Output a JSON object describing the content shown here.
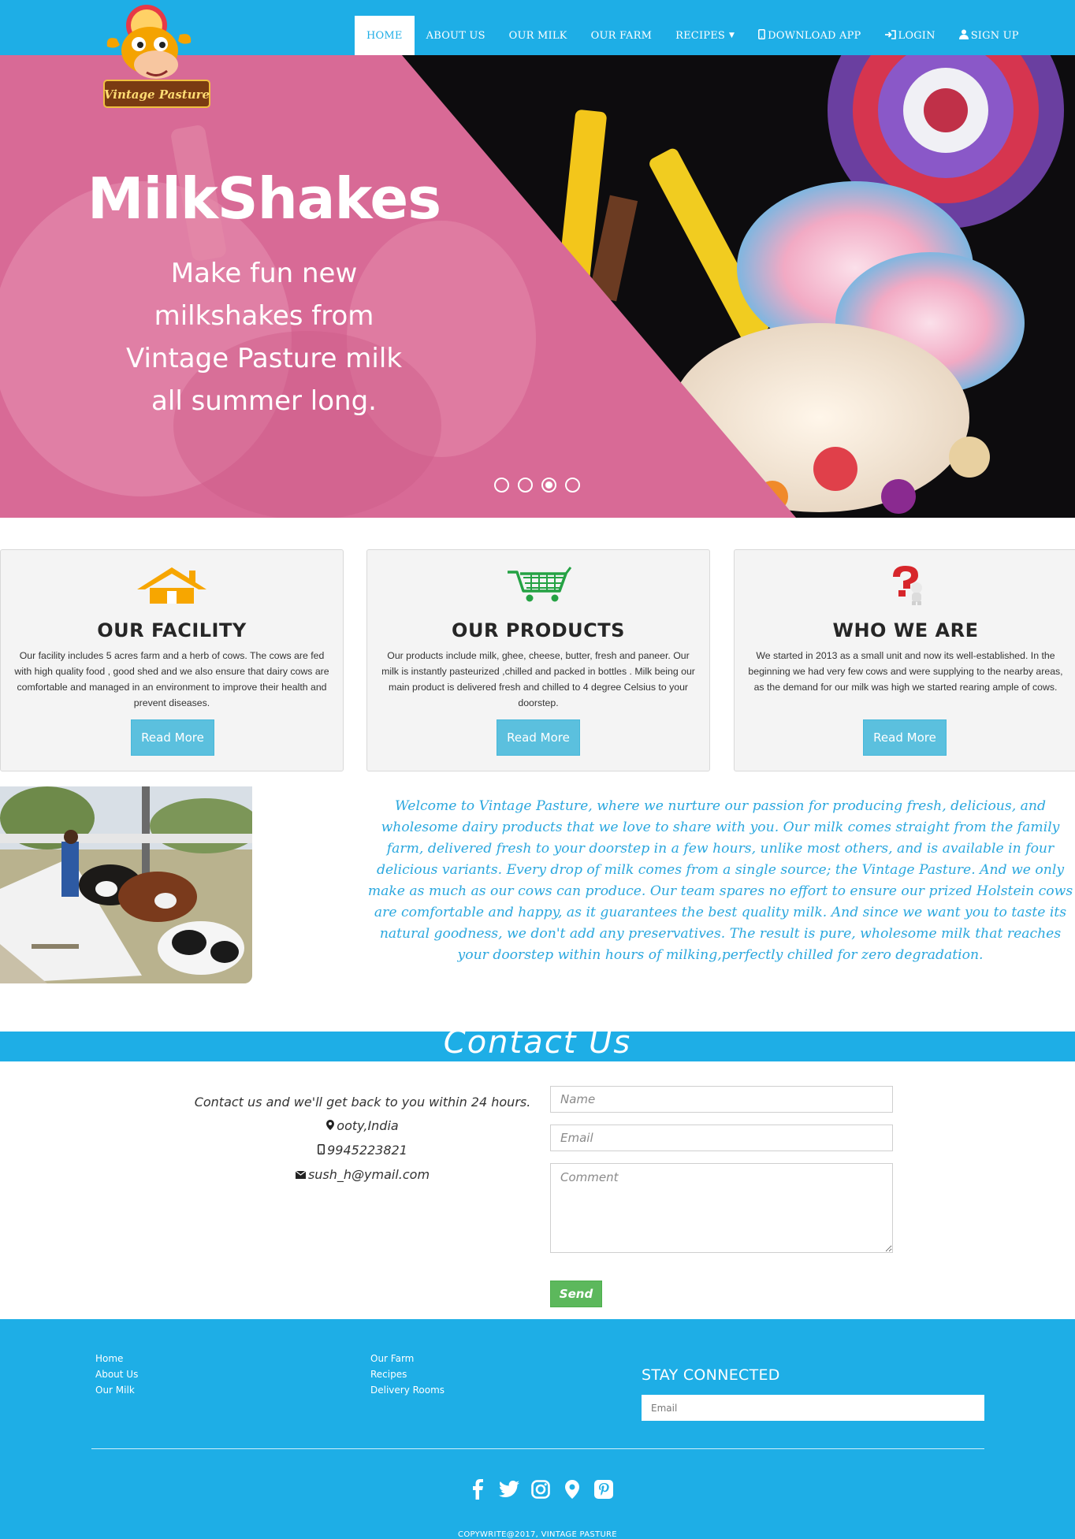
{
  "nav": {
    "logo_text": "Vintage Pasture",
    "items": [
      {
        "label": "HOME",
        "active": true
      },
      {
        "label": "ABOUT US"
      },
      {
        "label": "OUR MILK"
      },
      {
        "label": "OUR FARM"
      },
      {
        "label": "RECIPES"
      },
      {
        "label": "DOWNLOAD APP",
        "icon": "phone-icon"
      },
      {
        "label": "LOGIN",
        "icon": "login-icon"
      },
      {
        "label": "SIGN UP",
        "icon": "user-icon"
      }
    ]
  },
  "hero": {
    "title": "MilkShakes",
    "subtitle": "Make fun new milkshakes from Vintage Pasture milk all summer long.",
    "slide_count": 4,
    "active_slide": 3
  },
  "features": [
    {
      "icon": "house-icon",
      "title": "OUR FACILITY",
      "text": "Our facility includes 5 acres farm and a herb of cows. The cows are fed with high quality food , good shed and we also ensure that dairy cows are comfortable and managed in an environment to improve their health and prevent diseases.",
      "button": "Read More"
    },
    {
      "icon": "shopping-cart-icon",
      "title": "OUR PRODUCTS",
      "text": "Our products include milk, ghee, cheese, butter, fresh and paneer. Our milk is instantly pasteurized ,chilled and packed in bottles . Milk being our main product is delivered fresh and chilled to 4 degree Celsius to your doorstep.",
      "button": "Read More"
    },
    {
      "icon": "question-mark-figure-icon",
      "title": "WHO WE ARE",
      "text": "We started in 2013 as a small unit and now its well-established. In the beginning we had very few cows and were supplying to the nearby areas, as the demand for our milk was high we started rearing ample of cows.",
      "button": "Read More"
    }
  ],
  "about": {
    "text": "Welcome to Vintage Pasture, where we nurture our passion for producing fresh, delicious, and wholesome dairy products that we love to share with you. Our milk comes straight from the family farm, delivered fresh to your doorstep in a few hours, unlike most others, and is available in four delicious variants. Every drop of milk comes from a single source; the Vintage Pasture. And we only make as much as our cows can produce. Our team spares no effort to ensure our prized Holstein cows are comfortable and happy, as it guarantees the best quality milk. And since we want you to taste its natural goodness, we don't add any preservatives. The result is pure, wholesome milk that reaches your doorstep within hours of milking,perfectly chilled for zero degradation."
  },
  "contact": {
    "title": "Contact Us",
    "intro": "Contact us and we'll get back to you within 24 hours.",
    "location": "ooty,India",
    "phone": "9945223821",
    "email": "sush_h@ymail.com",
    "name_placeholder": "Name",
    "email_placeholder": "Email",
    "comment_placeholder": "Comment",
    "send_label": "Send"
  },
  "footer": {
    "col1": [
      "Home",
      "About Us",
      "Our Milk"
    ],
    "col2": [
      "Our Farm",
      "Recipes",
      "Delivery Rooms"
    ],
    "stay_connected": "STAY CONNECTED",
    "email_placeholder": "Email",
    "socials": [
      "facebook-icon",
      "twitter-icon",
      "instagram-icon",
      "map-marker-icon",
      "pinterest-icon"
    ],
    "copyright": "COPYWRITE@2017, VINTAGE PASTURE"
  },
  "colors": {
    "brand_blue": "#1eaee6",
    "hero_pink": "#d86a96",
    "button_info": "#5bc0de",
    "button_success": "#5cb85c",
    "about_text": "#2aa7de"
  }
}
